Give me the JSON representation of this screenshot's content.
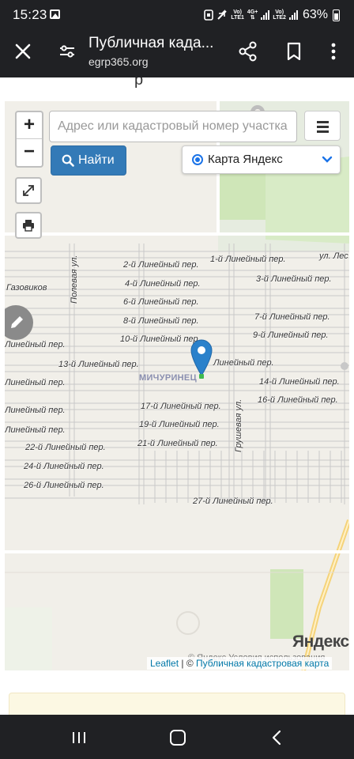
{
  "status_bar": {
    "time": "15:23",
    "network_top_1": "Vo)",
    "network_bottom_1": "LTE1",
    "network_top_2": "4G+",
    "network_top_3": "Vo)",
    "network_bottom_3": "LTE2",
    "battery": "63%"
  },
  "browser": {
    "title": "Публичная када...",
    "domain": "egrp365.org",
    "icons": [
      "close-icon",
      "site-settings-icon",
      "share-icon",
      "bookmark-icon",
      "more-vert-icon"
    ]
  },
  "page": {
    "cut_text": "р"
  },
  "map": {
    "zoom_in": "+",
    "zoom_out": "−",
    "search_placeholder": "Адрес или кадастровый номер участка",
    "find_button": "Найти",
    "layer_selected": "Карта Яндекс",
    "place_name": "МИЧУРИНЕЦ",
    "streets": {
      "s1": "1-й Линейный пер.",
      "s2": "2-й Линейный пер.",
      "s3": "3-й Линейный пер.",
      "s4": "4-й Линейный пер.",
      "s6": "6-й Линейный пер.",
      "s7": "7-й Линейный пер.",
      "s8": "8-й Линейный пер.",
      "s9": "9-й Линейный пер.",
      "s10": "10-й Линейный пер.",
      "s11": "Линейный пер.",
      "s12": "Линейный пер.",
      "s13": "13-й Линейный пер.",
      "s14": "14-й Линейный пер.",
      "s15": "Линейный пер.",
      "s16": "16-й Линейный пер.",
      "s17": "17-й Линейный пер.",
      "s18": "Линейный пер.",
      "s19": "19-й Линейный пер.",
      "s20": "Линейный пер.",
      "s21": "21-й Линейный пер.",
      "s22": "22-й Линейный пер.",
      "s24": "24-й Линейный пер.",
      "s26": "26-й Линейный пер.",
      "s27": "27-й Линейный пер.",
      "gazovikov": "Газовиков",
      "polevaya": "Полевая ул.",
      "grushevaya": "Грушевая ул.",
      "les": "ул. Лес"
    },
    "yandex_logo": "Яндекс",
    "yandex_terms": "© Яндекс  Условия использования",
    "attribution_leaflet": "Leaflet",
    "attribution_sep": " | © ",
    "attribution_cadastre": "Публичная кадастровая карта"
  },
  "colors": {
    "system_bar": "#202124",
    "find_button": "#337ab7",
    "marker": "#2a81cb",
    "map_bg": "#f1efe9",
    "parcel_line": "#c9c9c9",
    "green_area": "#cfe6b8",
    "road_highlight": "#f5d37a"
  }
}
